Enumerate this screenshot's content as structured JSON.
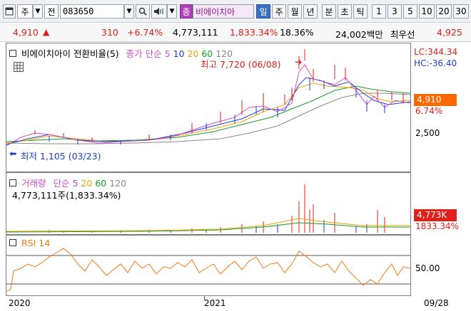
{
  "toolbar": {
    "window_icon": "window-icon",
    "market_label": "주",
    "type_label": "전",
    "code": "083650",
    "stock_name": "비에이치아",
    "stock_badge": "종",
    "periods": [
      "일",
      "주",
      "월",
      "년",
      "분",
      "초",
      "틱"
    ],
    "intervals": [
      "1",
      "3",
      "5",
      "10",
      "20",
      "30"
    ]
  },
  "quote": {
    "price": "4,910",
    "change": "310",
    "change_pct": "+6.74%",
    "volume": "4,773,111",
    "volume_ratio": "1,833.34%",
    "turnover": "18.36%",
    "amount": "24,002백만",
    "priority_label": "최우선",
    "priority_price": "4,925"
  },
  "price_panel": {
    "title": "비에이치아이 전환비율(5)",
    "ma_label": "종가 단순",
    "ma_periods": [
      "5",
      "10",
      "20",
      "60",
      "120"
    ],
    "high_note": "최고 7,720 (06/08)",
    "low_note": "최저 1,105 (03/23)",
    "lc": "LC:344.34",
    "hc": "HC:-36.40",
    "current_price": "4,910",
    "current_pct": "6.74%",
    "axis_tick": "2,500"
  },
  "volume_panel": {
    "title": "거래량",
    "ma_label": "단순",
    "ma_periods": [
      "5",
      "20",
      "60",
      "120"
    ],
    "value_text": "4,773,111주(1,833.34%)",
    "current_volume": "4,773K",
    "current_pct": "1833.34%"
  },
  "rsi_panel": {
    "title": "RSI 14",
    "axis_tick": "50.00"
  },
  "time_axis": {
    "labels": [
      "2020",
      "2021"
    ],
    "right_label": "09/28"
  },
  "colors": {
    "up": "#e0201a",
    "down": "#1c3fd0",
    "ma5": "#d04ed0",
    "ma10": "#1c3fd0",
    "ma20": "#f0a000",
    "ma60": "#1a9a2a",
    "ma120": "#888888"
  }
}
